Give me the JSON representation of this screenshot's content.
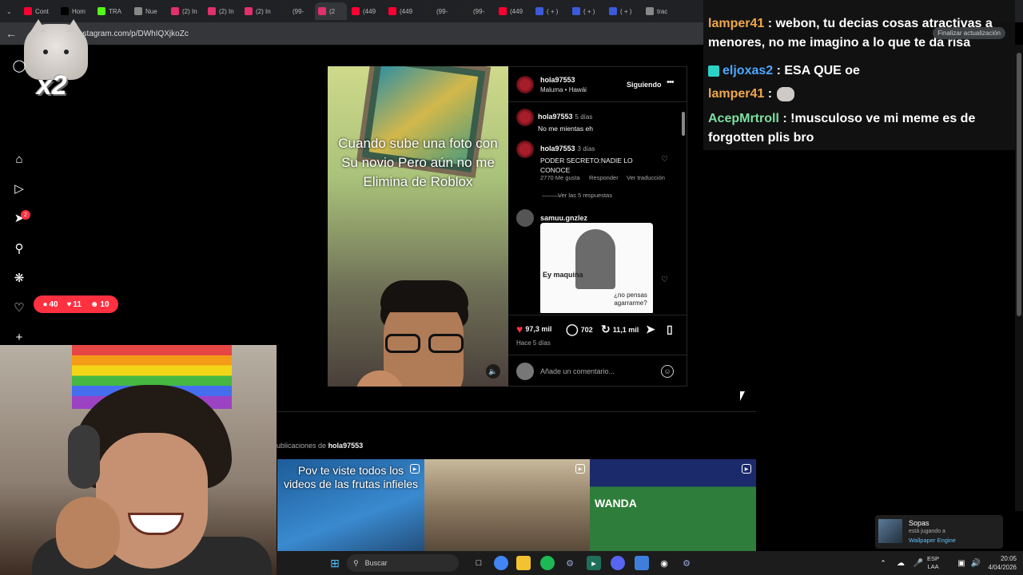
{
  "browser": {
    "tabs": [
      {
        "label": "Cont",
        "color": "#ff0033"
      },
      {
        "label": "Hom",
        "color": "#000000"
      },
      {
        "label": "TRA",
        "color": "#53fc18"
      },
      {
        "label": "Nue",
        "color": "#888888"
      },
      {
        "label": "(2) In",
        "color": "#e1306c"
      },
      {
        "label": "(2) In",
        "color": "#e1306c"
      },
      {
        "label": "(2) In",
        "color": "#e1306c"
      },
      {
        "label": "(99-",
        "color": "#222222"
      },
      {
        "label": "(2",
        "color": "#e1306c"
      },
      {
        "label": "(449",
        "color": "#ff0033"
      },
      {
        "label": "(449",
        "color": "#ff0033"
      },
      {
        "label": "(99-",
        "color": "#222222"
      },
      {
        "label": "(99-",
        "color": "#222222"
      },
      {
        "label": "(449",
        "color": "#ff0033"
      },
      {
        "label": "( + )",
        "color": "#3b5bdb"
      },
      {
        "label": "( + )",
        "color": "#3b5bdb"
      },
      {
        "label": "( + )",
        "color": "#3b5bdb"
      },
      {
        "label": "trac",
        "color": "#888888"
      }
    ],
    "url": "nstagram.com/p/DWhIQXjkoZc",
    "update_label": "Finalizar actualización"
  },
  "overlay": {
    "multiplier": "x2"
  },
  "ig_nav": {
    "notif_count": "2",
    "activity": {
      "comments": "40",
      "likes": "11",
      "followers": "10"
    }
  },
  "post": {
    "user": "hola97553",
    "subtitle": "Maluma • Hawái",
    "follow_label": "Siguiendo",
    "overlay_text": "Cuando sube una foto con Su novio Pero aún no me Elimina de Roblox",
    "comments": [
      {
        "user": "hola97553",
        "time": "5 días",
        "text": "No me mientas eh"
      },
      {
        "user": "hola97553",
        "time": "3 días",
        "text": "PODER SECRETO:NADIE LO CONOCE",
        "likes": "2770 Me gusta",
        "reply": "Responder",
        "translate": "Ver traducción",
        "replies": "Ver las 5 respuestas"
      },
      {
        "user": "samuu.gnzlez",
        "meme_top": "Ey maquina",
        "meme_bottom": "¿no pensas agarrarme?"
      }
    ],
    "likes": "97,3 mil",
    "comment_count": "702",
    "reposts": "11,1 mil",
    "date": "Hace 5 días",
    "add_comment_placeholder": "Añade un comentario..."
  },
  "more_posts": {
    "label": "ublicaciones de",
    "user": "hola97553",
    "thumb1_text": "Pov te viste todos los videos de las frutas infieles",
    "thumb3_text": "WANDA"
  },
  "chat": [
    {
      "name": "lamper41",
      "color": "#f0a84a",
      "text": ": webon, tu decias cosas atractivas a menores, no me imagino a lo que te da risa"
    },
    {
      "name": "eljoxas2",
      "color": "#4aa8ff",
      "text": ": ESA QUE oe"
    },
    {
      "name": "lamper41",
      "color": "#f0a84a",
      "text": ":"
    },
    {
      "name": "AcepMrtroll",
      "color": "#7de0a0",
      "text": ": !musculoso ve mi meme es de forgotten plis bro"
    }
  ],
  "toast": {
    "name": "Sopas",
    "status": "está jugando a",
    "game": "Wallpaper Engine"
  },
  "taskbar": {
    "search_label": "Buscar",
    "lang_top": "ESP",
    "lang_bottom": "LAA",
    "time": "20:05",
    "date": "4/04/2026"
  }
}
